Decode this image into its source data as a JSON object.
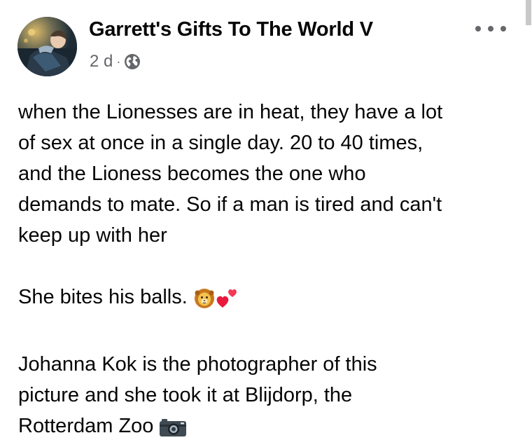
{
  "post": {
    "author": "Garrett's Gifts To The World V",
    "time": "2 d",
    "separator": "·",
    "privacy_icon": "globe-icon",
    "paragraphs": [
      [
        "when the Lionesses are in heat, they have a lot",
        "of sex at once in a single day. 20 to 40 times,",
        "and the Lioness becomes the one who",
        "demands to mate. So if a man is tired and can't",
        "keep up with her"
      ],
      [
        "She bites his balls."
      ],
      [
        "Johanna Kok is the photographer  of this",
        "picture and she took it at Blijdorp, the",
        "Rotterdam Zoo"
      ]
    ],
    "emojis": {
      "paragraph_2": [
        "lion-face-emoji",
        "two-hearts-emoji"
      ],
      "paragraph_3": [
        "camera-emoji"
      ]
    }
  },
  "colors": {
    "text_primary": "#050505",
    "text_secondary": "#65676b",
    "background": "#ffffff"
  }
}
